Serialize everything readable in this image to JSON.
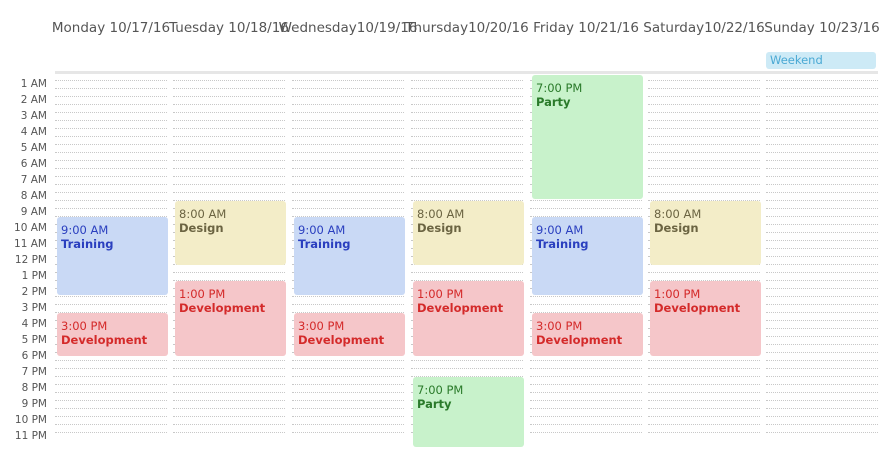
{
  "days": [
    {
      "label": "Monday 10/17/16"
    },
    {
      "label": "Tuesday 10/18/16"
    },
    {
      "label": "Wednesday\n10/19/16"
    },
    {
      "label": "Thursday\n10/20/16"
    },
    {
      "label": "Friday 10/21/16"
    },
    {
      "label": "Saturday\n10/22/16"
    },
    {
      "label": "Sunday 10/23/16"
    }
  ],
  "allday": [
    {
      "day": 6,
      "label": "Weekend"
    }
  ],
  "hours": [
    "1 AM",
    "2 AM",
    "3 AM",
    "4 AM",
    "5 AM",
    "6 AM",
    "7 AM",
    "8 AM",
    "9 AM",
    "10 AM",
    "11 AM",
    "12 PM",
    "1 PM",
    "2 PM",
    "3 PM",
    "4 PM",
    "5 PM",
    "6 PM",
    "7 PM",
    "8 PM",
    "9 PM",
    "10 PM",
    "11 PM"
  ],
  "events": [
    {
      "day": 0,
      "time": "9:00 AM",
      "title": "Training",
      "color": "blue",
      "start": 8.3,
      "end": 13.2
    },
    {
      "day": 0,
      "time": "3:00 PM",
      "title": "Development",
      "color": "red",
      "start": 14.3,
      "end": 17.0
    },
    {
      "day": 1,
      "time": "8:00 AM",
      "title": "Design",
      "color": "yellow",
      "start": 7.3,
      "end": 11.3
    },
    {
      "day": 1,
      "time": "1:00 PM",
      "title": "Development",
      "color": "red",
      "start": 12.3,
      "end": 17.0
    },
    {
      "day": 2,
      "time": "9:00 AM",
      "title": "Training",
      "color": "blue",
      "start": 8.3,
      "end": 13.2
    },
    {
      "day": 2,
      "time": "3:00 PM",
      "title": "Development",
      "color": "red",
      "start": 14.3,
      "end": 17.0
    },
    {
      "day": 3,
      "time": "8:00 AM",
      "title": "Design",
      "color": "yellow",
      "start": 7.3,
      "end": 11.3
    },
    {
      "day": 3,
      "time": "1:00 PM",
      "title": "Development",
      "color": "red",
      "start": 12.3,
      "end": 17.0
    },
    {
      "day": 3,
      "time": "7:00 PM",
      "title": "Party",
      "color": "green",
      "start": 18.3,
      "end": 22.7
    },
    {
      "day": 4,
      "time": "7:00 PM",
      "title": "Party",
      "color": "green",
      "start": -0.8,
      "end": 7.2
    },
    {
      "day": 4,
      "time": "9:00 AM",
      "title": "Training",
      "color": "blue",
      "start": 8.3,
      "end": 13.2
    },
    {
      "day": 4,
      "time": "3:00 PM",
      "title": "Development",
      "color": "red",
      "start": 14.3,
      "end": 17.0
    },
    {
      "day": 5,
      "time": "8:00 AM",
      "title": "Design",
      "color": "yellow",
      "start": 7.3,
      "end": 11.3
    },
    {
      "day": 5,
      "time": "1:00 PM",
      "title": "Development",
      "color": "red",
      "start": 12.3,
      "end": 17.0
    }
  ]
}
